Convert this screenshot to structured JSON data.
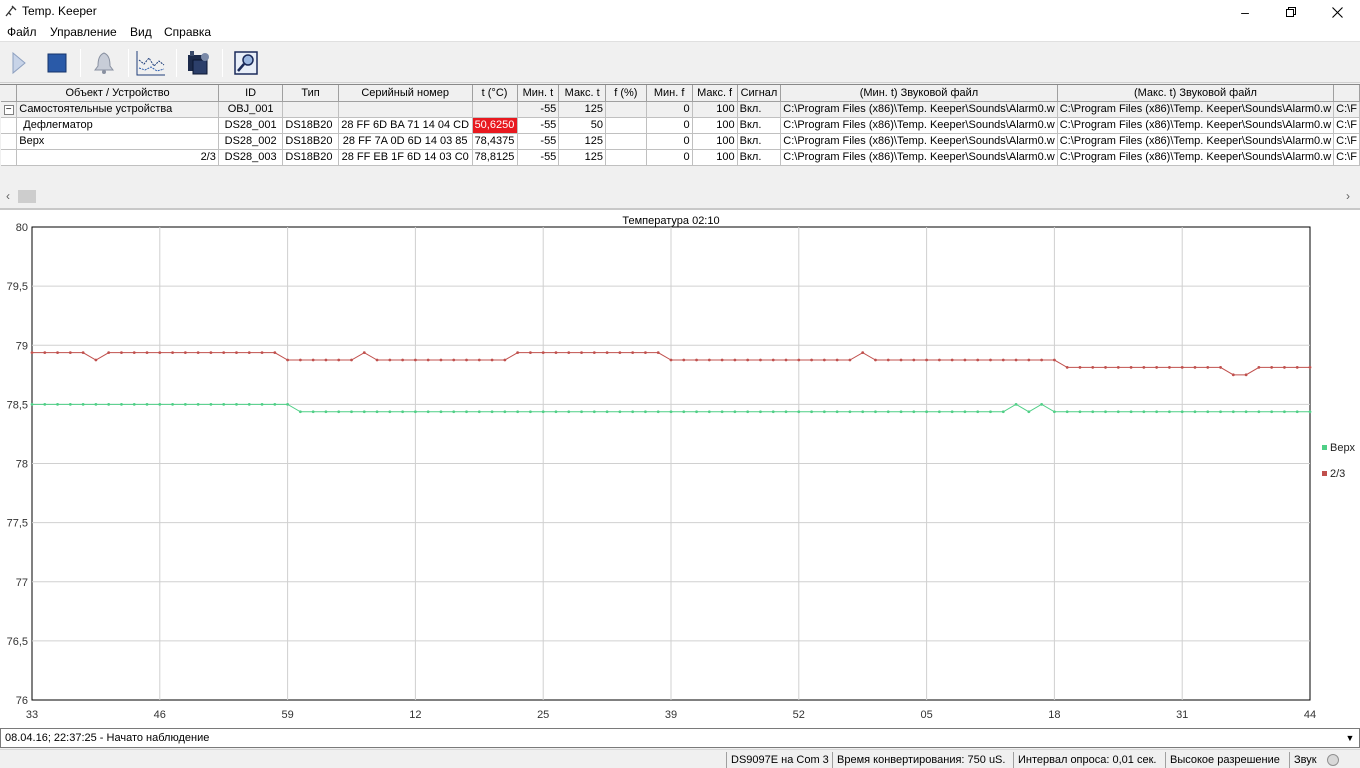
{
  "window": {
    "title": "Temp. Keeper"
  },
  "menu": [
    "Файл",
    "Управление",
    "Вид",
    "Справка"
  ],
  "toolbar": [
    {
      "name": "start-button",
      "icon": "play-icon"
    },
    {
      "name": "stop-button",
      "icon": "stop-icon"
    },
    {
      "name": "alarm-button",
      "icon": "bell-icon"
    },
    {
      "name": "chart-button",
      "icon": "chart-icon"
    },
    {
      "name": "devices-button",
      "icon": "devices-icon"
    },
    {
      "name": "export-button",
      "icon": "magnifier-icon"
    }
  ],
  "grid": {
    "columns": [
      "Объект / Устройство",
      "ID",
      "Тип",
      "Серийный номер",
      "t (°C)",
      "Мин. t",
      "Макс. t",
      "f (%)",
      "Мин. f",
      "Макс. f",
      "Сигнал",
      "(Мин. t) Звуковой файл",
      "(Макс. t) Звуковой файл",
      ""
    ],
    "rows": [
      {
        "group": true,
        "expander": "−",
        "name": "Самостоятельные устройства",
        "id": "OBJ_001",
        "type": "",
        "serial": "",
        "t": "",
        "tmin": "-55",
        "tmax": "125",
        "f": "",
        "fmin": "0",
        "fmax": "100",
        "signal": "Вкл.",
        "file_min": "C:\\Program Files (x86)\\Temp. Keeper\\Sounds\\Alarm0.w",
        "file_max": "C:\\Program Files (x86)\\Temp. Keeper\\Sounds\\Alarm0.w",
        "extra": "C:\\F"
      },
      {
        "group": false,
        "name": "Дефлегматор",
        "id": "DS28_001",
        "type": "DS18B20",
        "serial": "28 FF 6D BA 71 14 04 CD",
        "t": "50,6250",
        "alarm": true,
        "tmin": "-55",
        "tmax": "50",
        "f": "",
        "fmin": "0",
        "fmax": "100",
        "signal": "Вкл.",
        "file_min": "C:\\Program Files (x86)\\Temp. Keeper\\Sounds\\Alarm0.w",
        "file_max": "C:\\Program Files (x86)\\Temp. Keeper\\Sounds\\Alarm0.w",
        "extra": "C:\\F"
      },
      {
        "group": false,
        "name": "Верх",
        "id": "DS28_002",
        "type": "DS18B20",
        "serial": "28 FF 7A 0D 6D 14 03 85",
        "t": "78,4375",
        "tmin": "-55",
        "tmax": "125",
        "f": "",
        "fmin": "0",
        "fmax": "100",
        "signal": "Вкл.",
        "file_min": "C:\\Program Files (x86)\\Temp. Keeper\\Sounds\\Alarm0.w",
        "file_max": "C:\\Program Files (x86)\\Temp. Keeper\\Sounds\\Alarm0.w",
        "extra": "C:\\F"
      },
      {
        "group": false,
        "name": "2/3",
        "nameAlign": "right",
        "id": "DS28_003",
        "type": "DS18B20",
        "serial": "28 FF EB 1F 6D 14 03 C0",
        "t": "78,8125",
        "tmin": "-55",
        "tmax": "125",
        "f": "",
        "fmin": "0",
        "fmax": "100",
        "signal": "Вкл.",
        "file_min": "C:\\Program Files (x86)\\Temp. Keeper\\Sounds\\Alarm0.w",
        "file_max": "C:\\Program Files (x86)\\Temp. Keeper\\Sounds\\Alarm0.w",
        "extra": "C:\\F"
      }
    ]
  },
  "chart_data": {
    "type": "line",
    "title": "Температура 02:10",
    "ylim": [
      76,
      80
    ],
    "yticks": [
      "80",
      "79,5",
      "79",
      "78,5",
      "78",
      "77,5",
      "77",
      "76,5",
      "76"
    ],
    "xticks": [
      "33",
      "46",
      "59",
      "12",
      "25",
      "39",
      "52",
      "05",
      "18",
      "31",
      "44"
    ],
    "series": [
      {
        "name": "Верх",
        "color": "#4fcf86",
        "values": [
          78.5,
          78.5,
          78.5,
          78.5,
          78.5,
          78.5,
          78.5,
          78.5,
          78.5,
          78.5,
          78.5,
          78.5,
          78.5,
          78.5,
          78.5,
          78.5,
          78.5,
          78.5,
          78.5,
          78.5,
          78.5,
          78.4375,
          78.4375,
          78.4375,
          78.4375,
          78.4375,
          78.4375,
          78.4375,
          78.4375,
          78.4375,
          78.4375,
          78.4375,
          78.4375,
          78.4375,
          78.4375,
          78.4375,
          78.4375,
          78.4375,
          78.4375,
          78.4375,
          78.4375,
          78.4375,
          78.4375,
          78.4375,
          78.4375,
          78.4375,
          78.4375,
          78.4375,
          78.4375,
          78.4375,
          78.4375,
          78.4375,
          78.4375,
          78.4375,
          78.4375,
          78.4375,
          78.4375,
          78.4375,
          78.4375,
          78.4375,
          78.4375,
          78.4375,
          78.4375,
          78.4375,
          78.4375,
          78.4375,
          78.4375,
          78.4375,
          78.4375,
          78.4375,
          78.4375,
          78.4375,
          78.4375,
          78.4375,
          78.4375,
          78.4375,
          78.4375,
          78.5,
          78.4375,
          78.5,
          78.4375,
          78.4375,
          78.4375,
          78.4375,
          78.4375,
          78.4375,
          78.4375,
          78.4375,
          78.4375,
          78.4375,
          78.4375,
          78.4375,
          78.4375,
          78.4375,
          78.4375,
          78.4375,
          78.4375,
          78.4375,
          78.4375,
          78.4375,
          78.4375
        ]
      },
      {
        "name": "2/3",
        "color": "#c0504d",
        "values": [
          78.9375,
          78.9375,
          78.9375,
          78.9375,
          78.9375,
          78.875,
          78.9375,
          78.9375,
          78.9375,
          78.9375,
          78.9375,
          78.9375,
          78.9375,
          78.9375,
          78.9375,
          78.9375,
          78.9375,
          78.9375,
          78.9375,
          78.9375,
          78.875,
          78.875,
          78.875,
          78.875,
          78.875,
          78.875,
          78.9375,
          78.875,
          78.875,
          78.875,
          78.875,
          78.875,
          78.875,
          78.875,
          78.875,
          78.875,
          78.875,
          78.875,
          78.9375,
          78.9375,
          78.9375,
          78.9375,
          78.9375,
          78.9375,
          78.9375,
          78.9375,
          78.9375,
          78.9375,
          78.9375,
          78.9375,
          78.875,
          78.875,
          78.875,
          78.875,
          78.875,
          78.875,
          78.875,
          78.875,
          78.875,
          78.875,
          78.875,
          78.875,
          78.875,
          78.875,
          78.875,
          78.9375,
          78.875,
          78.875,
          78.875,
          78.875,
          78.875,
          78.875,
          78.875,
          78.875,
          78.875,
          78.875,
          78.875,
          78.875,
          78.875,
          78.875,
          78.875,
          78.8125,
          78.8125,
          78.8125,
          78.8125,
          78.8125,
          78.8125,
          78.8125,
          78.8125,
          78.8125,
          78.8125,
          78.8125,
          78.8125,
          78.8125,
          78.75,
          78.75,
          78.8125,
          78.8125,
          78.8125,
          78.8125,
          78.8125
        ]
      }
    ],
    "legend_position": "right",
    "grid": true
  },
  "log": {
    "text": "08.04.16; 22:37:25 - Начато наблюдение"
  },
  "status": [
    "DS9097E на Com 3",
    "Время конвертирования: 750 uS.",
    "Интервал опроса: 0,01 сек.",
    "Высокое разрешение",
    "Звук"
  ]
}
